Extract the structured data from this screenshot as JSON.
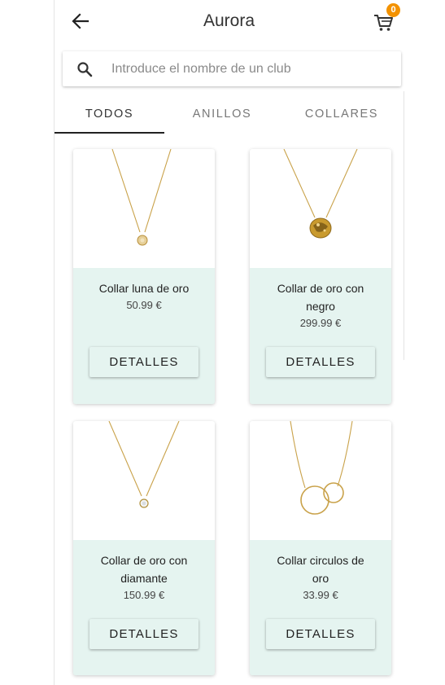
{
  "header": {
    "title": "Aurora",
    "cart_count": "0",
    "back_icon": "arrow-left-icon",
    "cart_icon": "shopping-cart-icon"
  },
  "search": {
    "placeholder": "Introduce el nombre de un club",
    "value": "",
    "icon": "search-icon"
  },
  "tabs": [
    {
      "label": "TODOS",
      "active": true
    },
    {
      "label": "ANILLOS",
      "active": false
    },
    {
      "label": "COLLARES",
      "active": false
    }
  ],
  "products": [
    {
      "name": "Collar luna de oro",
      "price": "50.99 €",
      "button": "DETALLES",
      "image": "gold-moon-pendant-necklace"
    },
    {
      "name": "Collar de oro con negro",
      "price": "299.99 €",
      "button": "DETALLES",
      "image": "gold-disc-pendant-necklace"
    },
    {
      "name": "Collar de oro con diamante",
      "price": "150.99 €",
      "button": "DETALLES",
      "image": "gold-diamond-pendant-necklace"
    },
    {
      "name": "Collar circulos de oro",
      "price": "33.99 €",
      "button": "DETALLES",
      "image": "gold-interlocking-circles-necklace"
    }
  ],
  "colors": {
    "card_background": "#e5f4f0",
    "badge": "#f39200",
    "gold": "#c9a24a"
  }
}
